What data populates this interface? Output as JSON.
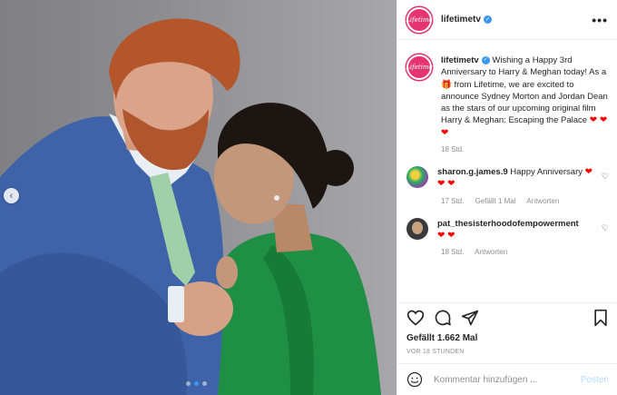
{
  "post": {
    "username": "lifetimetv",
    "avatar_text": "Lifetime",
    "more_label": "•••",
    "caption": "Wishing a Happy 3rd Anniversary to Harry & Meghan today! As a",
    "caption_gift": "🎁",
    "caption_rest": "from Lifetime, we are excited to announce Sydney Morton and Jordan Dean as the stars of our upcoming original film Harry & Meghan: Escaping the Palace",
    "caption_hearts": "❤ ❤ ❤",
    "caption_time": "18 Std.",
    "likes": "Gefällt 1.662 Mal",
    "timestamp": "VOR 18 STUNDEN"
  },
  "comments": [
    {
      "username": "sharon.g.james.9",
      "text": "Happy Anniversary",
      "hearts": "❤ ❤ ❤",
      "time": "17 Std.",
      "likes": "Gefällt 1 Mal",
      "reply": "Antworten"
    },
    {
      "username": "pat_thesisterhoodofempowerment",
      "text": "",
      "hearts": "❤ ❤",
      "time": "18 Std.",
      "reply": "Antworten"
    }
  ],
  "add_comment": {
    "placeholder": "Kommentar hinzufügen ...",
    "post_label": "Posten"
  },
  "colors": {
    "accent": "#3897f0",
    "brand": "#e53470",
    "muted": "#8e8e8e",
    "heart": "#ff0000"
  }
}
